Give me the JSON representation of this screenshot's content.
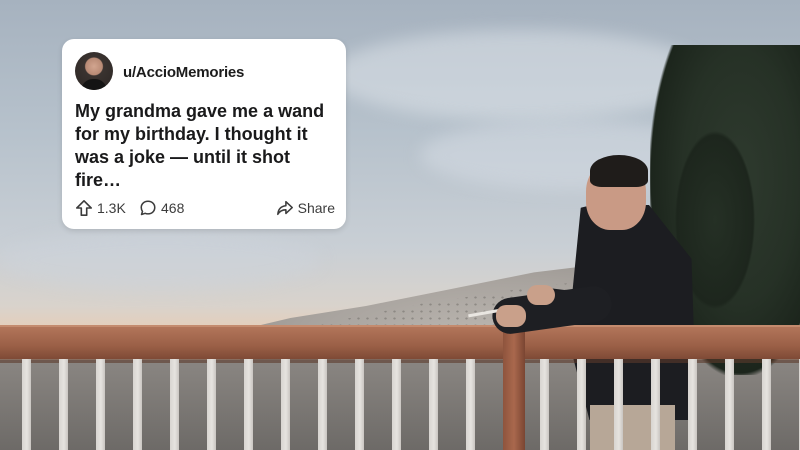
{
  "post": {
    "username": "u/AccioMemories",
    "title": "My grandma gave me a wand for my birthday. I thought it was a joke — until it shot fire…",
    "upvotes": "1.3K",
    "comments": "468",
    "share_label": "Share"
  },
  "icons": {
    "upvote": "upvote-arrow-icon",
    "comment": "comment-bubble-icon",
    "share": "share-arrow-icon"
  },
  "colors": {
    "card_bg": "#ffffff",
    "text": "#1a1a1b"
  }
}
